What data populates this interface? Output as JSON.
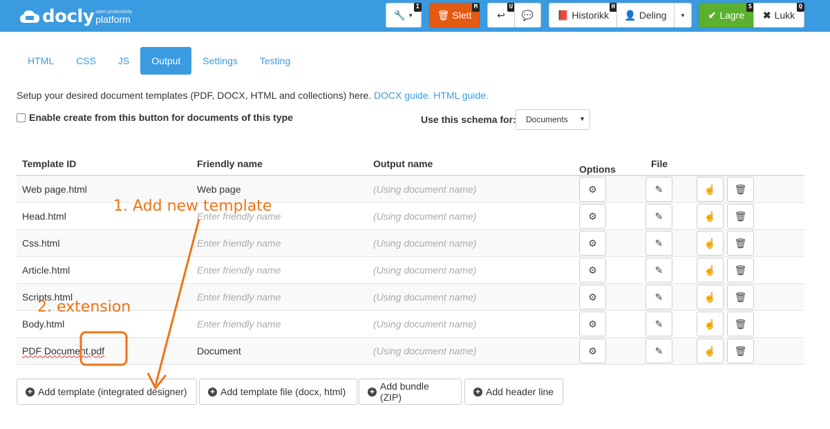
{
  "brand": {
    "name": "docly",
    "tagline_small": "open productivity",
    "tagline": "platform"
  },
  "toolbar": {
    "tools_shortcut": "I",
    "delete_label": "Slett",
    "delete_shortcut": "M",
    "undo_shortcut": "U",
    "history_label": "Historikk",
    "history_shortcut": "H",
    "share_label": "Deling",
    "save_label": "Lagre",
    "save_shortcut": "S",
    "close_label": "Lukk",
    "close_shortcut": "Q"
  },
  "tabs": [
    "HTML",
    "CSS",
    "JS",
    "Output",
    "Settings",
    "Testing"
  ],
  "description": {
    "text": "Setup your desired document templates (PDF, DOCX, HTML and collections) here.",
    "docx_link": "DOCX guide.",
    "html_link": "HTML guide."
  },
  "enable_label": "Enable create from this button for documents of this type",
  "schema": {
    "label": "Use this schema for:",
    "value": "Documents"
  },
  "columns": {
    "template_id": "Template ID",
    "friendly_name": "Friendly name",
    "output_name": "Output name",
    "options": "Options",
    "file": "File"
  },
  "placeholders": {
    "friendly": "Enter friendly name",
    "output": "(Using document name)"
  },
  "rows": [
    {
      "id": "Web page.html",
      "friendly": "Web page"
    },
    {
      "id": "Head.html",
      "friendly": ""
    },
    {
      "id": "Css.html",
      "friendly": ""
    },
    {
      "id": "Article.html",
      "friendly": ""
    },
    {
      "id": "Scripts.html",
      "friendly": ""
    },
    {
      "id": "Body.html",
      "friendly": ""
    },
    {
      "id": "PDF Document.pdf",
      "friendly": "Document"
    }
  ],
  "actions": [
    "Add template (integrated designer)",
    "Add template file (docx, html)",
    "Add bundle (ZIP)",
    "Add header line"
  ],
  "annotations": {
    "step1": "1. Add new template",
    "step2": "2. extension"
  },
  "colors": {
    "primary": "#3a9be0",
    "danger": "#e55a12",
    "success": "#5cb02f",
    "annotation": "#f07314"
  }
}
